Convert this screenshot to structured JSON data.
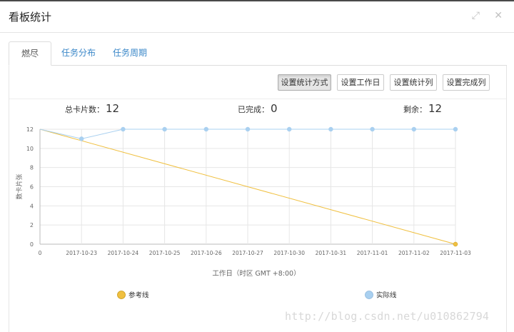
{
  "window": {
    "title": "看板统计",
    "expand_icon": "expand-icon",
    "close_icon": "close-icon"
  },
  "tabs": [
    {
      "label": "燃尽图",
      "active": true
    },
    {
      "label": "任务分布",
      "active": false
    },
    {
      "label": "任务周期",
      "active": false
    }
  ],
  "toolbar": {
    "buttons": [
      "设置统计方式",
      "设置工作日",
      "设置统计列",
      "设置完成列"
    ]
  },
  "stats": {
    "total_label": "总卡片数：",
    "total_value": "12",
    "done_label": "已完成：",
    "done_value": "0",
    "remaining_label": "剩余：",
    "remaining_value": "12"
  },
  "chart_data": {
    "type": "line",
    "x": [
      "0",
      "2017-10-23",
      "2017-10-24",
      "2017-10-25",
      "2017-10-26",
      "2017-10-27",
      "2017-10-30",
      "2017-10-31",
      "2017-11-01",
      "2017-11-02",
      "2017-11-03"
    ],
    "series": [
      {
        "name": "参考线",
        "color": "#f0c040",
        "values": [
          12,
          null,
          null,
          null,
          null,
          null,
          null,
          null,
          null,
          null,
          0
        ]
      },
      {
        "name": "实际线",
        "color": "#a9d0f0",
        "values": [
          12,
          11,
          12,
          12,
          12,
          12,
          12,
          12,
          12,
          12,
          12
        ]
      }
    ],
    "ylabel": "数卡片张",
    "xlabel": "工作日（时区 GMT +8:00）",
    "ylim": [
      0,
      12
    ],
    "yticks": [
      0,
      2,
      4,
      6,
      8,
      10,
      12
    ],
    "grid": true,
    "legend_position": "bottom"
  },
  "watermark": "http://blog.csdn.net/u010862794"
}
